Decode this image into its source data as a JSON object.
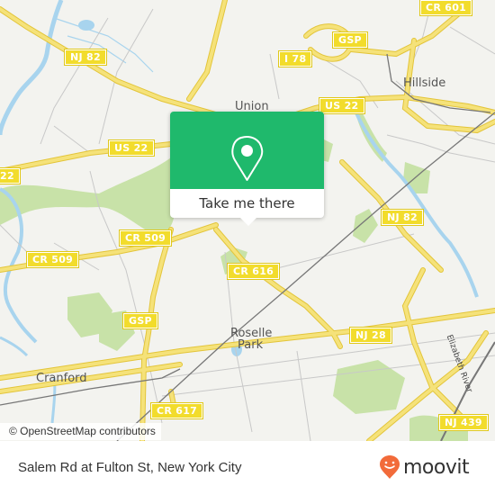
{
  "map": {
    "attribution": "© OpenStreetMap contributors",
    "colors": {
      "background": "#f3f3ef",
      "road_major": "#f5e27a",
      "road_outline": "#e3c53a",
      "water": "#a8d4ee",
      "park": "#c8e2a8",
      "rail": "#777777",
      "minor_road": "#bdbdbd"
    },
    "places": [
      {
        "name": "Union"
      },
      {
        "name": "Hillside"
      },
      {
        "name": "Roselle"
      },
      {
        "name": "Park"
      },
      {
        "name": "Cranford"
      }
    ],
    "road_labels": [
      {
        "label": "I 78"
      },
      {
        "label": "GSP"
      },
      {
        "label": "CR 601"
      },
      {
        "label": "NJ 82"
      },
      {
        "label": "US 22"
      },
      {
        "label": "US 22"
      },
      {
        "label": "22"
      },
      {
        "label": "CR 509"
      },
      {
        "label": "CR 509"
      },
      {
        "label": "NJ 82"
      },
      {
        "label": "CR 616"
      },
      {
        "label": "GSP"
      },
      {
        "label": "NJ 28"
      },
      {
        "label": "CR 617"
      },
      {
        "label": "NJ 439"
      }
    ],
    "river_label": "Elizabeth River"
  },
  "popup": {
    "action_label": "Take me there",
    "icon": "location-pin-icon",
    "accent": "#1fb96c"
  },
  "footer": {
    "stop_title": "Salem Rd at Fulton St, New York City",
    "brand": "moovit",
    "brand_color": "#f26b3a"
  }
}
